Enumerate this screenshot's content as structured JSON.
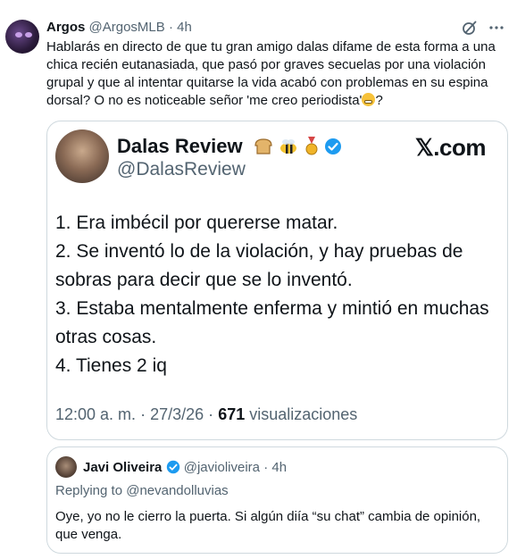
{
  "colors": {
    "text": "#0f1419",
    "muted": "#536471",
    "border": "#cfd9de",
    "verified": "#1d9bf0"
  },
  "post": {
    "author_name": "Argos",
    "author_handle": "@ArgosMLB",
    "separator": "·",
    "time": "4h",
    "text_main": "Hablarás en directo de que tu gran amigo dalas difame de esta forma a una chica recién eutanasiada, que pasó por graves secuelas por una violación grupal y que al intentar quitarse la vida acabó con problemas en su espina dorsal? O no es noticeable señor 'me creo periodista'",
    "text_end": "?"
  },
  "quoted": {
    "name": "Dalas Review",
    "handle": "@DalasReview",
    "brand": "𝕏.com",
    "lines": [
      "1. Era imbécil por quererse matar.",
      "2. Se inventó lo de la violación, y hay pruebas de sobras para decir que se lo inventó.",
      "3. Estaba mentalmente enferma y mintió en muchas otras cosas.",
      "4. Tienes 2 iq"
    ],
    "time": "12:00 a. m.",
    "date": "27/3/26",
    "views_count": "671",
    "views_label": "visualizaciones",
    "separator": "·"
  },
  "reply": {
    "name": "Javi Oliveira",
    "handle": "@javioliveira",
    "separator": "·",
    "time": "4h",
    "replying_to": "Replying to @nevandolluvias",
    "text": "Oye, yo no le cierro la puerta. Si algún diía “su chat” cambia de opinión, que venga."
  }
}
